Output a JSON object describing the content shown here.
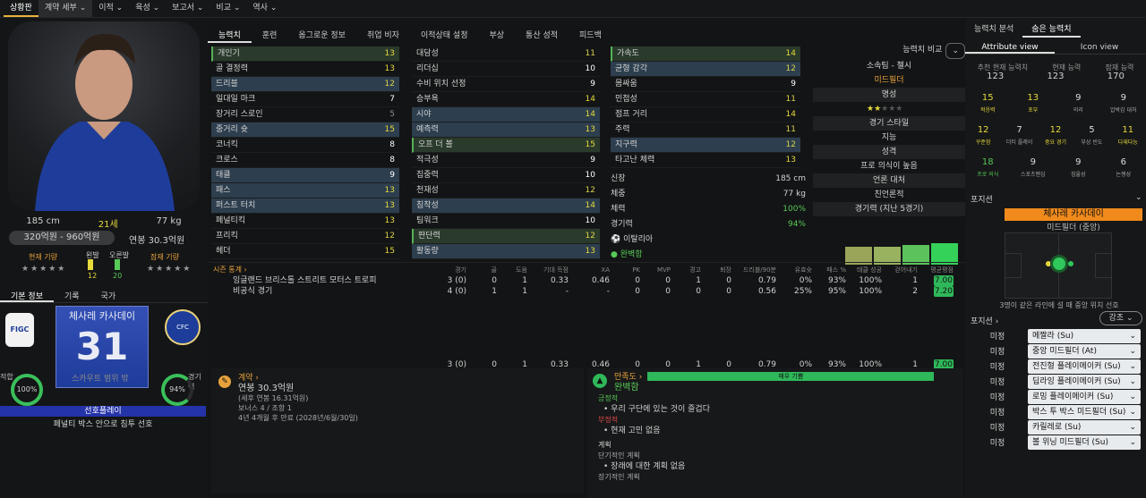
{
  "nav": [
    "상황판",
    "계약 세부",
    "이적",
    "육성",
    "보고서",
    "비교",
    "역사"
  ],
  "left": {
    "height": "185 cm",
    "age": "21세",
    "weight": "77 kg",
    "value": "320억원 - 960억원",
    "wage": "연봉 30.3억원",
    "cur_role_label": "현재 기량",
    "foot_left_label": "왼발",
    "foot_right_label": "오른발",
    "foot_left": "12",
    "foot_right": "20",
    "pot_label": "잠재 기량",
    "tabs": [
      "기본 정보",
      "기록",
      "국가"
    ],
    "name_kr": "체사레 카사데이",
    "number": "31",
    "scout": "스카우트 범위 밖",
    "ring_left": "100%",
    "ring_right": "94%",
    "ring_left_label": "적합",
    "ring_right_label": "경기력",
    "play_style": "선호플레이",
    "play_pref": "페널티 박스 안으로 침투 선호"
  },
  "tabs": [
    "능력치",
    "훈련",
    "옵그로운 정보",
    "취업 비자",
    "이적상태 설정",
    "부상",
    "통산 성적",
    "피드백"
  ],
  "col1": [
    {
      "n": "개인기",
      "v": "13",
      "c": "g",
      "s": "ghl"
    },
    {
      "n": "골 결정력",
      "v": "13",
      "c": "g",
      "s": ""
    },
    {
      "n": "드리블",
      "v": "12",
      "c": "y",
      "s": "hl"
    },
    {
      "n": "일대일 마크",
      "v": "7",
      "c": "w",
      "s": ""
    },
    {
      "n": "장거리 스로인",
      "v": "5",
      "c": "d",
      "s": ""
    },
    {
      "n": "중거리 슛",
      "v": "15",
      "c": "g",
      "s": "hl"
    },
    {
      "n": "코너킥",
      "v": "8",
      "c": "w",
      "s": ""
    },
    {
      "n": "크로스",
      "v": "8",
      "c": "w",
      "s": ""
    },
    {
      "n": "태클",
      "v": "9",
      "c": "w",
      "s": "hl"
    },
    {
      "n": "패스",
      "v": "13",
      "c": "g",
      "s": "hl"
    },
    {
      "n": "퍼스트 터치",
      "v": "13",
      "c": "g",
      "s": "hl"
    },
    {
      "n": "페널티킥",
      "v": "13",
      "c": "g",
      "s": ""
    },
    {
      "n": "프리킥",
      "v": "12",
      "c": "y",
      "s": ""
    },
    {
      "n": "헤더",
      "v": "15",
      "c": "g",
      "s": ""
    }
  ],
  "col2": [
    {
      "n": "대담성",
      "v": "11",
      "c": "y",
      "s": ""
    },
    {
      "n": "리더십",
      "v": "10",
      "c": "w",
      "s": ""
    },
    {
      "n": "수비 위치 선정",
      "v": "9",
      "c": "w",
      "s": ""
    },
    {
      "n": "승부욕",
      "v": "14",
      "c": "g",
      "s": ""
    },
    {
      "n": "시야",
      "v": "14",
      "c": "g",
      "s": "hl"
    },
    {
      "n": "예측력",
      "v": "13",
      "c": "g",
      "s": "hl"
    },
    {
      "n": "오프 더 볼",
      "v": "15",
      "c": "g",
      "s": "ghl"
    },
    {
      "n": "적극성",
      "v": "9",
      "c": "w",
      "s": ""
    },
    {
      "n": "집중력",
      "v": "10",
      "c": "w",
      "s": ""
    },
    {
      "n": "천재성",
      "v": "12",
      "c": "y",
      "s": ""
    },
    {
      "n": "침착성",
      "v": "14",
      "c": "g",
      "s": "hl"
    },
    {
      "n": "팀워크",
      "v": "10",
      "c": "w",
      "s": ""
    },
    {
      "n": "판단력",
      "v": "12",
      "c": "y",
      "s": "ghl"
    },
    {
      "n": "활동량",
      "v": "13",
      "c": "g",
      "s": "hl"
    }
  ],
  "col3": [
    {
      "n": "가속도",
      "v": "14",
      "c": "g",
      "s": "ghl"
    },
    {
      "n": "균형 감각",
      "v": "12",
      "c": "y",
      "s": "hl"
    },
    {
      "n": "몸싸움",
      "v": "9",
      "c": "w",
      "s": ""
    },
    {
      "n": "민첩성",
      "v": "11",
      "c": "y",
      "s": ""
    },
    {
      "n": "점프 거리",
      "v": "14",
      "c": "g",
      "s": ""
    },
    {
      "n": "주력",
      "v": "11",
      "c": "y",
      "s": ""
    },
    {
      "n": "지구력",
      "v": "12",
      "c": "y",
      "s": "hl"
    },
    {
      "n": "타고난 체력",
      "v": "13",
      "c": "g",
      "s": ""
    }
  ],
  "physical": {
    "h_label": "신장",
    "h": "185 cm",
    "w_label": "체중",
    "w": "77 kg",
    "cond_label": "체력",
    "cond": "100%",
    "form_label": "경기력",
    "form": "94%",
    "nation": "이탈리아",
    "fit": "완벽함"
  },
  "info": {
    "compare": "능력치 비교",
    "club": "소속팀 - 첼시",
    "pos": "미드필더",
    "rep_label": "명성",
    "style_label": "경기 스타일",
    "style": "지능",
    "pers_label": "성격",
    "pers": "프로 의식이 높음",
    "media_label": "언론 대처",
    "media": "친언론적",
    "form_label": "경기력 (지난 5경기)"
  },
  "season": {
    "title": "시즌 통계",
    "headers": [
      "경기",
      "골",
      "도움",
      "기대 득점",
      "XA",
      "PK",
      "MVP",
      "경고",
      "퇴장",
      "드리블/90분",
      "유효슛",
      "패스 %",
      "태클 성공",
      "걷어내기",
      "평균평점"
    ],
    "row1": {
      "name": "잉글랜드 브리스톨 스트리트 모터스 트로피",
      "v": [
        "3 (0)",
        "0",
        "1",
        "0.33",
        "0.46",
        "0",
        "0",
        "1",
        "0",
        "0.79",
        "0%",
        "93%",
        "100%",
        "1",
        "7.00"
      ]
    },
    "row2": {
      "name": "비공식 경기",
      "v": [
        "4 (0)",
        "1",
        "1",
        "-",
        "-",
        "0",
        "0",
        "0",
        "0",
        "0.56",
        "25%",
        "95%",
        "100%",
        "2",
        "7.20"
      ]
    },
    "total": [
      "3 (0)",
      "0",
      "1",
      "0.33",
      "0.46",
      "0",
      "0",
      "1",
      "0",
      "0.79",
      "0%",
      "93%",
      "100%",
      "1",
      "7.00"
    ]
  },
  "contract": {
    "title": "계약",
    "wage": "연봉 30.3억원",
    "wage_sub": "(세후 연봉 16.31억원)",
    "bonus": "보너스 4 / 조항 1",
    "term": "4년 4개월 후 만료 (2028년/6월/30일)"
  },
  "happy": {
    "title": "만족도",
    "bar": "매우 기쁨",
    "status": "완벽함",
    "pos_label": "긍정적",
    "pos": "우리 구단에 있는 것이 즐겁다",
    "neg_label": "부정적",
    "neg": "현재 고민 없음",
    "plan_label": "계획",
    "short_label": "단기적인 계획",
    "short": "장래에 대한 계획 없음",
    "long_label": "장기적인 계획"
  },
  "right": {
    "tabs": [
      "능력치 분석",
      "숨은 능력치"
    ],
    "views": [
      "Attribute view",
      "Icon view"
    ],
    "hdr": [
      "추천 현재 능력치",
      "현재 능력",
      "잠재 능력"
    ],
    "hdrv": [
      "123",
      "123",
      "170"
    ],
    "r1": [
      {
        "v": "15",
        "l": "적응력",
        "c": "#e6d93c"
      },
      {
        "v": "13",
        "l": "포부",
        "c": "#e6d93c"
      },
      {
        "v": "9",
        "l": "의리",
        "c": "#ddd"
      },
      {
        "v": "9",
        "l": "압박감 대처",
        "c": "#ddd"
      }
    ],
    "r2": [
      {
        "v": "12",
        "l": "꾸준함",
        "c": "#e6d93c"
      },
      {
        "v": "7",
        "l": "더티 플레이",
        "c": "#ddd"
      },
      {
        "v": "12",
        "l": "중요 경기",
        "c": "#e6d93c"
      },
      {
        "v": "5",
        "l": "부상 빈도",
        "c": "#ddd"
      },
      {
        "v": "11",
        "l": "다재다능",
        "c": "#e6d93c"
      }
    ],
    "r3": [
      {
        "v": "18",
        "l": "프로 의식",
        "c": "#57c957"
      },
      {
        "v": "9",
        "l": "스포츠맨십",
        "c": "#ddd"
      },
      {
        "v": "9",
        "l": "침울성",
        "c": "#ddd"
      },
      {
        "v": "6",
        "l": "논쟁성",
        "c": "#ddd"
      }
    ],
    "pos_label": "포지션",
    "name_banner": "체사레 카사데이",
    "role": "미드필더 (중앙)",
    "note": "3명이 같은 라인에 설 때 중앙 위치 선호",
    "pos2": "포지션",
    "emph": "강조",
    "roles": [
      {
        "lvl": "미정",
        "r": "메짤라 (Su)"
      },
      {
        "lvl": "미정",
        "r": "중앙 미드필더 (At)"
      },
      {
        "lvl": "미정",
        "r": "전진형 플레이메이커 (Su)"
      },
      {
        "lvl": "미정",
        "r": "딥라잉 플레이메이커 (Su)"
      },
      {
        "lvl": "미정",
        "r": "로밍 플레이메이커 (Su)"
      },
      {
        "lvl": "미정",
        "r": "박스 투 박스 미드필더 (Su)"
      },
      {
        "lvl": "미정",
        "r": "카릴레로 (Su)"
      },
      {
        "lvl": "미정",
        "r": "볼 위닝 미드필더 (Su)"
      }
    ]
  }
}
